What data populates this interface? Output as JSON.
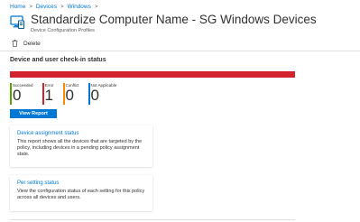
{
  "breadcrumb": {
    "items": [
      "Home",
      "Devices",
      "Windows"
    ],
    "separator": ">"
  },
  "header": {
    "title": "Standardize Computer Name - SG Windows Devices",
    "subtitle": "Device Configuration Profiles",
    "icon": "device-config-icon"
  },
  "toolbar": {
    "delete_label": "Delete",
    "delete_icon": "trash-icon"
  },
  "section": {
    "title": "Device and user check-in status"
  },
  "status_bar": {
    "color": "#d1222d"
  },
  "counts": [
    {
      "label": "Succeeded",
      "value": "0",
      "color": "#57a300"
    },
    {
      "label": "Error",
      "value": "1",
      "color": "#d1222d"
    },
    {
      "label": "Conflict",
      "value": "0",
      "color": "#ff8c00"
    },
    {
      "label": "Not Applicable",
      "value": "0",
      "color": "#0078d4"
    }
  ],
  "view_report_label": "View Report",
  "cards": [
    {
      "link": "Device assignment status",
      "description": "This report shows all the devices that are targeted by the policy, including devices in a pending policy assignment state."
    },
    {
      "link": "Per setting status",
      "description": "View the configuration status of each setting for this policy across all devices and users."
    }
  ],
  "colors": {
    "accent": "#0078d4",
    "error": "#d1222d"
  }
}
